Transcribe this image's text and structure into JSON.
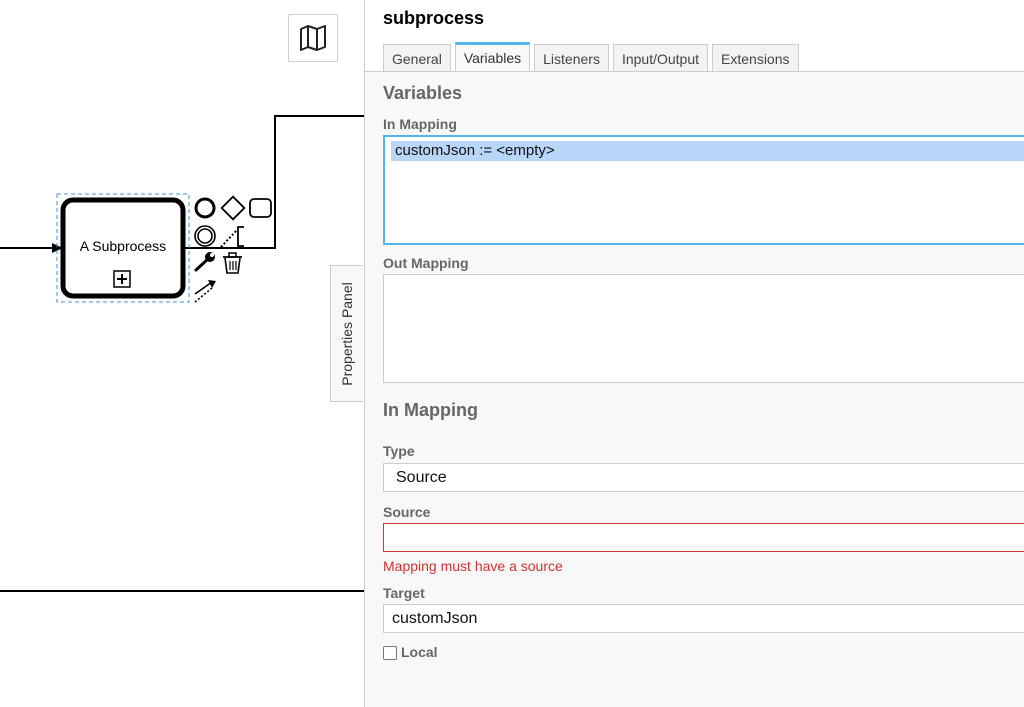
{
  "canvas": {
    "subprocess_label": "A Subprocess",
    "icons": [
      "map-icon",
      "start-event-icon",
      "gateway-icon",
      "task-icon",
      "intermediate-event-icon",
      "connect-icon",
      "annotation-icon",
      "wrench-icon",
      "trash-icon",
      "arrow-connect-icon",
      "expand-icon"
    ]
  },
  "panel_toggle": {
    "label": "Properties Panel"
  },
  "panel": {
    "title": "subprocess",
    "tabs": [
      {
        "label": "General"
      },
      {
        "label": "Variables"
      },
      {
        "label": "Listeners"
      },
      {
        "label": "Input/Output"
      },
      {
        "label": "Extensions"
      }
    ],
    "active_tab": "Variables",
    "section_title": "Variables",
    "in_mapping_label": "In Mapping",
    "in_mapping_items": [
      "customJson := <empty>"
    ],
    "out_mapping_label": "Out Mapping",
    "detail_title": "In Mapping",
    "type_label": "Type",
    "type_value": "Source",
    "source_label": "Source",
    "source_value": "",
    "source_error": "Mapping must have a source",
    "target_label": "Target",
    "target_value": "customJson",
    "local_label": "Local",
    "local_checked": false
  },
  "colors": {
    "accent": "#52b5e6",
    "selection": "#b8d6f8",
    "error": "#cc3333",
    "panel_bg": "#f8f8f8"
  }
}
